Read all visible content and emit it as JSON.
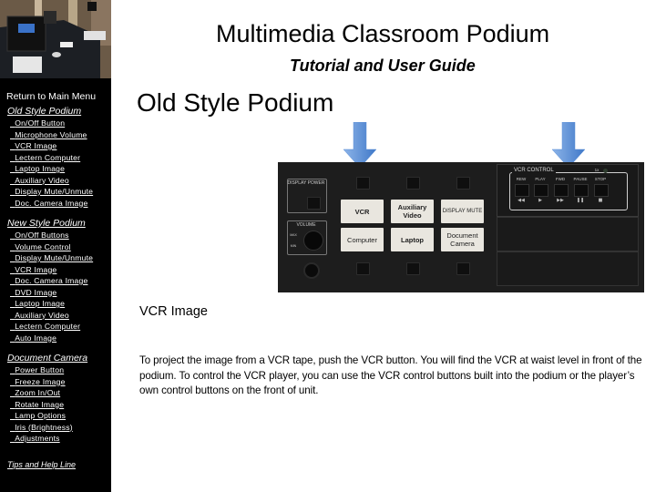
{
  "header": {
    "title": "Multimedia Classroom Podium",
    "subtitle": "Tutorial and User Guide"
  },
  "sidebar": {
    "return_label": "Return to Main Menu",
    "sections": [
      {
        "title": "Old Style Podium",
        "items": [
          "On/Off Button",
          "Microphone Volume",
          "VCR Image",
          "Lectern Computer",
          "Laptop Image",
          "Auxiliary Video",
          "Display Mute/Unmute",
          "Doc. Camera Image"
        ]
      },
      {
        "title": "New Style Podium",
        "items": [
          "On/Off Buttons",
          "Volume Control",
          "Display Mute/Unmute",
          "VCR Image",
          "Doc. Camera Image",
          "DVD Image",
          "Laptop Image",
          "Auxiliary Video",
          "Lectern Computer",
          "Auto Image"
        ]
      },
      {
        "title": "Document Camera",
        "items": [
          "Power Button",
          "Freeze Image",
          "Zoom In/Out",
          "Rotate Image",
          "Lamp Options",
          "Iris (Brightness)",
          "Adjustments"
        ]
      }
    ],
    "footer_link": "Tips and Help Line"
  },
  "main": {
    "section_title": "Old Style Podium",
    "panel": {
      "display_power": "DISPLAY POWER",
      "volume": "VOLUME",
      "vol_max": "MAX",
      "vol_min": "MIN",
      "source_buttons": [
        "VCR",
        "Auxiliary Video",
        "DISPLAY MUTE",
        "Computer",
        "Laptop",
        "Document Camera"
      ],
      "vcr_control_title": "VCR CONTROL",
      "vcr_indicator": "1x",
      "vcr_buttons": [
        {
          "label": "REW",
          "symbol": "◀◀"
        },
        {
          "label": "PLAY",
          "symbol": "▶"
        },
        {
          "label": "FWD",
          "symbol": "▶▶"
        },
        {
          "label": "PAUSE",
          "symbol": "❚❚"
        },
        {
          "label": "STOP",
          "symbol": "■"
        }
      ]
    },
    "arrow_color": "#4a86d4",
    "image_title": "VCR Image",
    "body_text": "To project the image from a VCR tape, push the VCR button. You will find the VCR at waist level in front of the podium. To control the VCR player, you can use the VCR control buttons built into the podium or the player’s own control buttons on the front of unit."
  }
}
